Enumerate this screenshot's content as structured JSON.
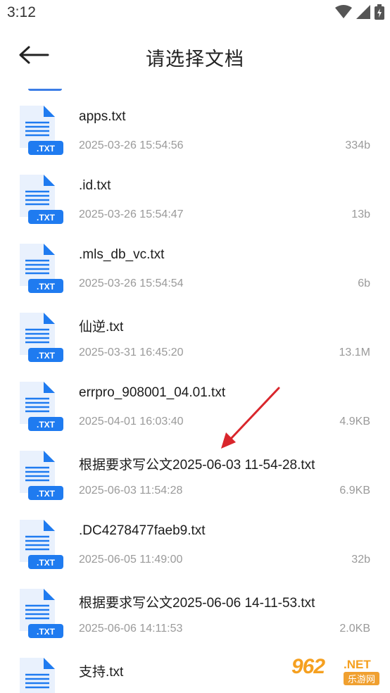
{
  "status_bar": {
    "time": "3:12",
    "icons": [
      "wifi-icon",
      "signal-icon",
      "battery-icon"
    ]
  },
  "app_bar": {
    "back_icon": "arrow-left-icon",
    "title": "请选择文档"
  },
  "colors": {
    "icon_blue": "#1f7bf0",
    "icon_light": "#e9f1fd",
    "secondary_text": "#9a9a9a",
    "arrow_red": "#d9262c",
    "watermark_orange": "#f5a020"
  },
  "file_badge": ".TXT",
  "files": [
    {
      "name": "apps.txt",
      "date": "2025-03-26 15:54:56",
      "size": "334b"
    },
    {
      "name": ".id.txt",
      "date": "2025-03-26 15:54:47",
      "size": "13b"
    },
    {
      "name": ".mls_db_vc.txt",
      "date": "2025-03-26 15:54:54",
      "size": "6b"
    },
    {
      "name": "仙逆.txt",
      "date": "2025-03-31 16:45:20",
      "size": "13.1M"
    },
    {
      "name": "errpro_908001_04.01.txt",
      "date": "2025-04-01 16:03:40",
      "size": "4.9KB"
    },
    {
      "name": "根据要求写公文2025-06-03 11-54-28.txt",
      "date": "2025-06-03 11:54:28",
      "size": "6.9KB"
    },
    {
      "name": ".DC4278477faeb9.txt",
      "date": "2025-06-05 11:49:00",
      "size": "32b"
    },
    {
      "name": "根据要求写公文2025-06-06 14-11-53.txt",
      "date": "2025-06-06 14:11:53",
      "size": "2.0KB"
    },
    {
      "name": "支持.txt",
      "date": "",
      "size": ""
    }
  ],
  "watermark": {
    "brand": "962",
    "suffix": ".NET",
    "sub": "乐游网"
  }
}
